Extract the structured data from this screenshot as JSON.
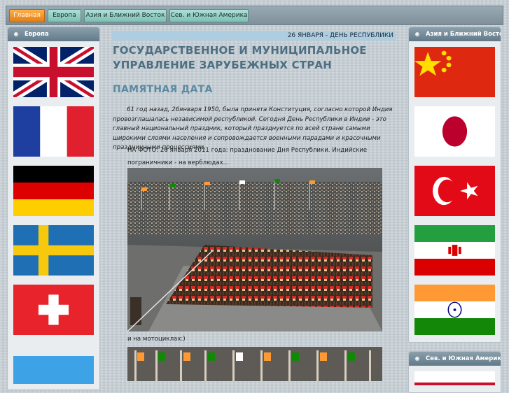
{
  "nav": {
    "tabs": [
      {
        "label": "Главная",
        "active": true
      },
      {
        "label": "Европа",
        "active": false
      },
      {
        "label": "Азия и Ближний Восток",
        "active": false
      },
      {
        "label": "Сев. и Южная Америка",
        "active": false
      }
    ]
  },
  "left_panel": {
    "title": "Европа",
    "flags": [
      "united-kingdom-flag",
      "france-flag",
      "germany-flag",
      "sweden-flag",
      "switzerland-flag"
    ]
  },
  "right_panel": {
    "title": "Азия и Ближний Восток",
    "flags": [
      "china-flag",
      "japan-flag",
      "turkey-flag",
      "iran-flag",
      "india-flag"
    ]
  },
  "right_panel_2": {
    "title": "Сев. и Южная Америка"
  },
  "main": {
    "ticker": "26 ЯНВАРЯ - ДЕНЬ РЕСПУБЛИКИ",
    "title": "ГОСУДАРСТВЕННОЕ И МУНИЦИПАЛЬНОЕ УПРАВЛЕНИЕ ЗАРУБЕЖНЫХ СТРАН",
    "section": "ПАМЯТНАЯ ДАТА",
    "paragraph": "61 год назад,  26января  1950, была принята Конституция, согласно которой Индия провозглашалась независимой республикой.  Сегодня День Республики в Индии - это главный национальный праздник, который празднуется по всей стране самыми широкими слоями населения и сопровождается военными парадами и красочными праздничными процессиями.",
    "caption1": "НА ФОТО: 26 января 2011 года: празднование Дня Республики. Индийские пограничники - на верблюдах...",
    "caption2": "и на мотоциклах:)"
  },
  "colors": {
    "nav_active": "#e47e10",
    "nav_inactive": "#7cc1b3",
    "panel_header": "#62798a",
    "title_color": "#4e6f82",
    "section_color": "#5c8aa3",
    "ticker_bg": "#aecde0"
  }
}
